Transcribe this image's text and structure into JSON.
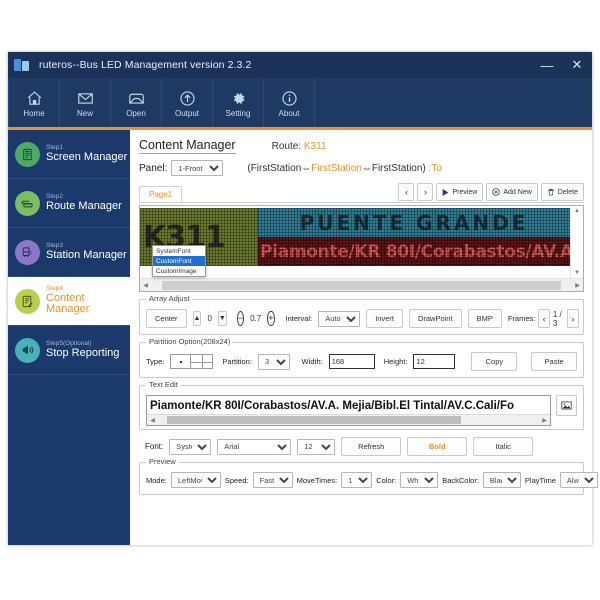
{
  "window": {
    "title": "ruteros--Bus LED Management version 2.3.2",
    "minimize": "—",
    "close": "✕"
  },
  "toolbar": {
    "items": [
      {
        "label": "Home",
        "icon": "home-icon"
      },
      {
        "label": "New",
        "icon": "envelope-icon"
      },
      {
        "label": "Open",
        "icon": "folder-open-icon"
      },
      {
        "label": "Output",
        "icon": "upload-arrow-icon"
      },
      {
        "label": "Setting",
        "icon": "gear-icon"
      },
      {
        "label": "About",
        "icon": "info-icon"
      }
    ]
  },
  "sidebar": {
    "items": [
      {
        "step": "Step1",
        "label": "Screen Manager",
        "color": "#4fa868",
        "icon": "screen-icon",
        "active": false
      },
      {
        "step": "Step2",
        "label": "Route Manager",
        "color": "#7cbf63",
        "icon": "route-icon",
        "active": false
      },
      {
        "step": "Step3",
        "label": "Station Manager",
        "color": "#8a79c9",
        "icon": "bus-icon",
        "active": false
      },
      {
        "step": "Step4",
        "label": "Content Manager",
        "color": "#b9cf4f",
        "icon": "content-icon",
        "active": true
      },
      {
        "step": "Step5(Optional)",
        "label": "Stop Reporting",
        "color": "#49b2b8",
        "icon": "megaphone-icon",
        "active": false
      }
    ]
  },
  "header": {
    "title": "Content Manager",
    "route_label": "Route:",
    "route_value": "K311",
    "panel_label": "Panel:",
    "panel_value": "1-Front",
    "panel_options": [
      "1-Front"
    ],
    "stations_open": "(FirstStation⇔",
    "stations_mid": "FirstStation",
    "stations_close": "⇔FirstStation)",
    "stations_to": ":To"
  },
  "tabs": {
    "page_tab": "Page1",
    "prev": "‹",
    "next": "›",
    "preview": "Preview",
    "add_new": "Add New",
    "delete": "Delete"
  },
  "led_preview": {
    "left_text": "K311",
    "top_text": "PUENTE GRANDE",
    "bottom_text": "Piamonte/KR 80I/Corabastos/AV.A.",
    "left_bg": "#6b7a2e",
    "top_bg": "#2f7d96",
    "bottom_bg": "#5c1414"
  },
  "array_adjust": {
    "caption": "Array Adjust",
    "center": "Center",
    "up": "▲",
    "down": "▼",
    "offset": "0",
    "minus": "−",
    "plus": "+",
    "scale": "0.7",
    "interval_label": "Interval:",
    "interval_value": "Auto",
    "interval_options": [
      "Auto"
    ],
    "invert": "Invert",
    "drawpoint": "DrawPoint",
    "bmp": "BMP",
    "frames_label": "Frames:",
    "frame_prev": "‹",
    "frame_value": "1 / 3",
    "frame_next": "›"
  },
  "partition": {
    "caption": "Partition Option(208x24)",
    "type_label": "Type:",
    "partition_label": "Partition:",
    "partition_value": "3",
    "partition_options": [
      "3"
    ],
    "width_label": "Width:",
    "width_value": "168",
    "height_label": "Height:",
    "height_value": "12",
    "copy": "Copy",
    "paste": "Paste"
  },
  "text_edit": {
    "caption": "Text Edit",
    "value": "Piamonte/KR 80I/Corabastos/AV.A. Mejia/Bibl.El Tintal/AV.C.Cali/Fo",
    "image_button": "image-icon"
  },
  "font_row": {
    "font_label": "Font:",
    "source_value": "SystemFo",
    "family_value": "Arial",
    "family_options": [
      "Arial"
    ],
    "size_value": "12",
    "size_options": [
      "12"
    ],
    "refresh": "Refresh",
    "bold": "Bold",
    "italic": "Italic"
  },
  "font_dropdown": {
    "options": [
      {
        "label": "SystemFont",
        "selected": false
      },
      {
        "label": "CustomFont",
        "selected": true
      },
      {
        "label": "CustomImage",
        "selected": false
      }
    ]
  },
  "preview_group": {
    "caption": "Preview",
    "mode_label": "Mode:",
    "mode_value": "LeftMove",
    "mode_options": [
      "LeftMove"
    ],
    "speed_label": "Speed:",
    "speed_value": "Fast",
    "speed_options": [
      "Fast"
    ],
    "movetimes_label": "MoveTimes:",
    "movetimes_value": "1",
    "movetimes_options": [
      "1"
    ],
    "color_label": "Color:",
    "color_value": "White",
    "color_options": [
      "White"
    ],
    "backcolor_label": "BackColor:",
    "backcolor_value": "Black",
    "backcolor_options": [
      "Black"
    ],
    "playtime_label": "PlayTime",
    "playtime_value": "Always",
    "playtime_options": [
      "Always"
    ]
  },
  "theme": {
    "accent": "#e8922e",
    "navy": "#1b3a6b",
    "titlebar": "#1b3359"
  }
}
